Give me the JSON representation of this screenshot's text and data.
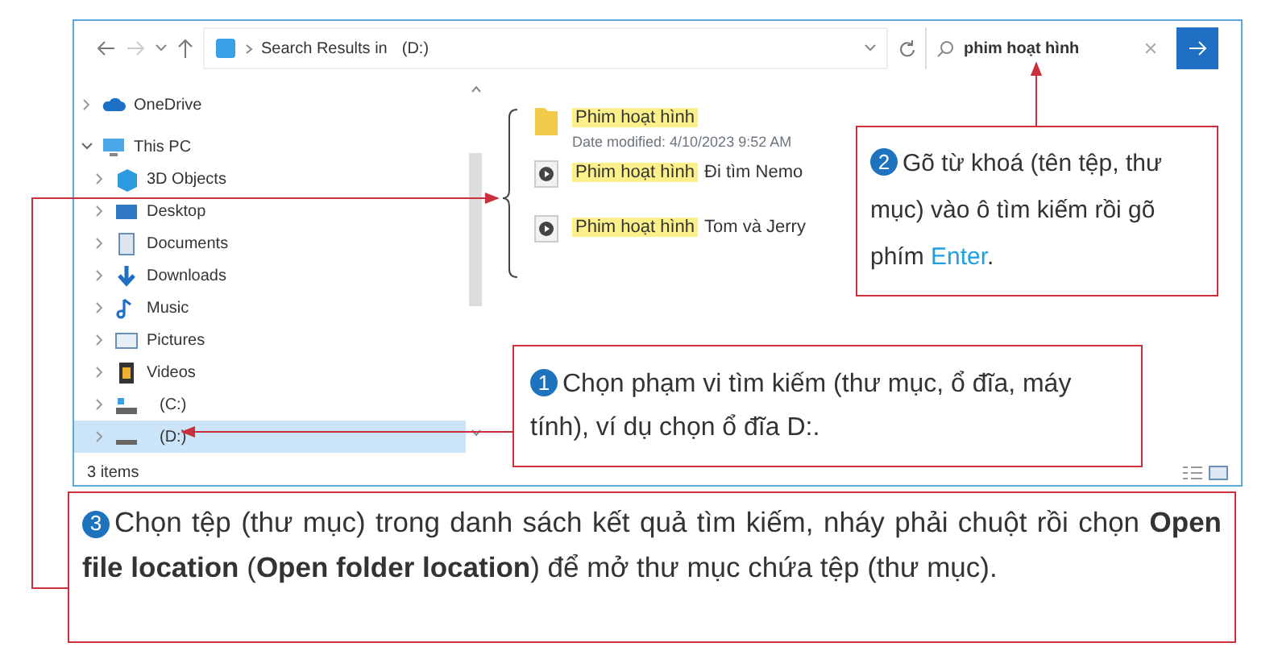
{
  "address_bar": {
    "location_prefix": "Search Results in",
    "location": "(D:)"
  },
  "search": {
    "value": "phim hoạt hình"
  },
  "sidebar": {
    "items": [
      {
        "label": "OneDrive",
        "kind": "cloud",
        "expanded": false,
        "selected": false
      },
      {
        "label": "This PC",
        "kind": "pc",
        "expanded": true,
        "selected": false,
        "children": [
          {
            "label": "3D Objects",
            "kind": "cube",
            "expanded": false,
            "selected": false
          },
          {
            "label": "Desktop",
            "kind": "desktop",
            "expanded": false,
            "selected": false
          },
          {
            "label": "Documents",
            "kind": "document",
            "expanded": false,
            "selected": false
          },
          {
            "label": "Downloads",
            "kind": "download",
            "expanded": false,
            "selected": false
          },
          {
            "label": "Music",
            "kind": "music",
            "expanded": false,
            "selected": false
          },
          {
            "label": "Pictures",
            "kind": "picture",
            "expanded": false,
            "selected": false
          },
          {
            "label": "Videos",
            "kind": "video",
            "expanded": false,
            "selected": false
          },
          {
            "label": "(C:)",
            "kind": "system-drive",
            "expanded": false,
            "selected": false
          },
          {
            "label": "(D:)",
            "kind": "drive",
            "expanded": false,
            "selected": true
          }
        ]
      }
    ]
  },
  "results": [
    {
      "kind": "folder",
      "highlight": "Phim hoạt hình",
      "meta": "Date modified: 4/10/2023 9:52 AM"
    },
    {
      "kind": "video",
      "highlight": "Phim hoạt hình",
      "rest": "Đi tìm Nemo"
    },
    {
      "kind": "video",
      "highlight": "Phim hoạt hình",
      "rest": "Tom và Jerry"
    }
  ],
  "status_bar": {
    "count": "3 items"
  },
  "callouts": [
    {
      "number": "2",
      "parts": [
        {
          "text": "Gõ từ khoá (tên tệp, thư mục) vào ô tìm kiếm rồi gõ phím ",
          "kind": "plain"
        },
        {
          "text": "Enter",
          "kind": "key"
        },
        {
          "text": ".",
          "kind": "plain"
        }
      ]
    },
    {
      "number": "1",
      "parts": [
        {
          "text": "Chọn phạm vi tìm kiếm (thư mục, ổ đĩa, máy tính), ví dụ chọn ổ đĩa D:.",
          "kind": "plain"
        }
      ]
    },
    {
      "number": "3",
      "parts": [
        {
          "text": "Chọn tệp (thư mục) trong danh sách kết quả tìm kiếm, nháy phải chuột rồi chọn **Open file location** (**Open folder location**) để mở thư mục chứa tệp (thư mục).",
          "kind": "rich"
        }
      ]
    }
  ]
}
